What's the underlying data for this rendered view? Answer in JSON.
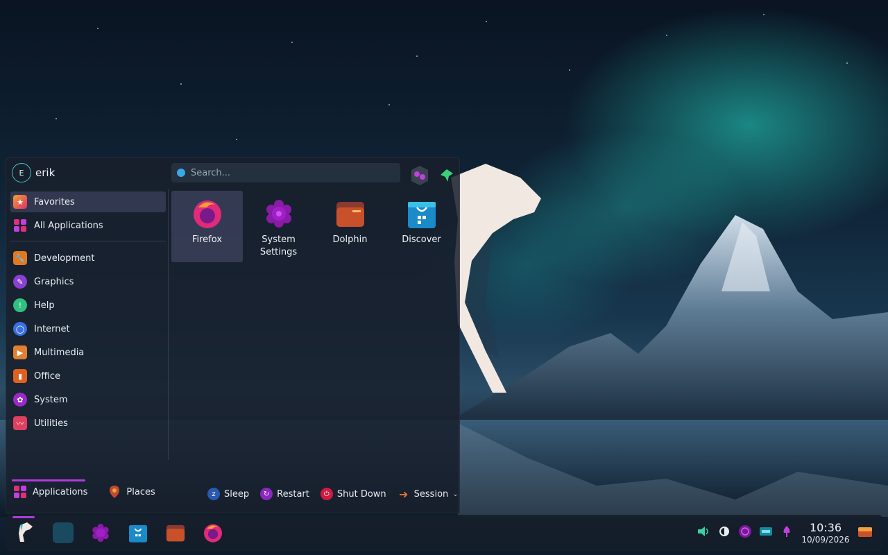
{
  "user": {
    "initial": "E",
    "name": "erik"
  },
  "search": {
    "placeholder": "Search..."
  },
  "categories": [
    {
      "label": "Favorites",
      "icon": "favorites-icon",
      "color": "#e8503a",
      "active": true
    },
    {
      "label": "All Applications",
      "icon": "all-apps-icon",
      "color": "#e0307a",
      "active": false
    },
    {
      "label": "Development",
      "icon": "wrench-icon",
      "color": "#e07a20"
    },
    {
      "label": "Graphics",
      "icon": "graphics-icon",
      "color": "#8a40d0"
    },
    {
      "label": "Help",
      "icon": "help-icon",
      "color": "#30c080"
    },
    {
      "label": "Internet",
      "icon": "globe-icon",
      "color": "#3a70e0"
    },
    {
      "label": "Multimedia",
      "icon": "play-icon",
      "color": "#e08030"
    },
    {
      "label": "Office",
      "icon": "office-icon",
      "color": "#e06020"
    },
    {
      "label": "System",
      "icon": "gear-icon",
      "color": "#9a2ac8"
    },
    {
      "label": "Utilities",
      "icon": "utilities-icon",
      "color": "#e04060"
    }
  ],
  "favorites": [
    {
      "label": "Firefox",
      "icon": "firefox-icon"
    },
    {
      "label": "System Settings",
      "icon": "settings-icon"
    },
    {
      "label": "Dolphin",
      "icon": "folder-icon"
    },
    {
      "label": "Discover",
      "icon": "store-icon"
    }
  ],
  "bottom_tabs": [
    {
      "label": "Applications",
      "icon": "apps-grid-icon",
      "active": true
    },
    {
      "label": "Places",
      "icon": "places-pin-icon",
      "active": false
    }
  ],
  "power": [
    {
      "label": "Sleep",
      "icon": "sleep-icon",
      "color": "#3a7ae0"
    },
    {
      "label": "Restart",
      "icon": "restart-icon",
      "color": "#a030d0"
    },
    {
      "label": "Shut Down",
      "icon": "shutdown-icon",
      "color": "#e02040"
    },
    {
      "label": "Session",
      "icon": "session-icon",
      "color": "#e07030"
    }
  ],
  "taskbar": {
    "apps": [
      "launcher-icon",
      "terminal-icon",
      "settings-icon",
      "store-icon",
      "folder-icon",
      "firefox-icon"
    ]
  },
  "tray": [
    "volume-icon",
    "brightness-icon",
    "network-icon",
    "battery-icon",
    "notifications-icon"
  ],
  "clock": {
    "time": "10:36",
    "date": "10/09/2026"
  }
}
